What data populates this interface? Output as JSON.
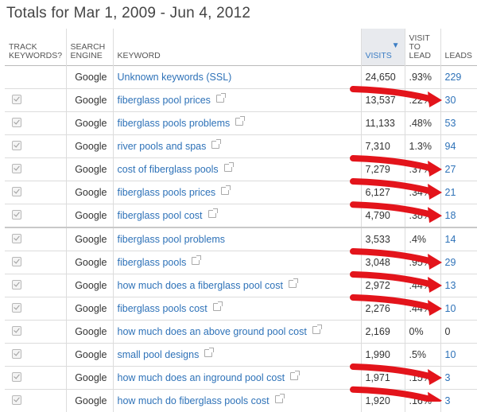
{
  "title": "Totals for Mar 1, 2009 - Jun 4, 2012",
  "headers": {
    "track": "TRACK KEYWORDS?",
    "engine": "SEARCH ENGINE",
    "keyword": "KEYWORD",
    "visits": "VISITS",
    "v2l": "VISIT TO LEAD",
    "leads": "LEADS"
  },
  "rows": [
    {
      "tracked": false,
      "engine": "Google",
      "keyword": "Unknown keywords (SSL)",
      "link": false,
      "visits": "24,650",
      "v2l": ".93%",
      "leads": "229"
    },
    {
      "tracked": true,
      "engine": "Google",
      "keyword": "fiberglass pool prices",
      "link": true,
      "visits": "13,537",
      "v2l": ".22%",
      "leads": "30"
    },
    {
      "tracked": true,
      "engine": "Google",
      "keyword": "fiberglass pools problems",
      "link": true,
      "visits": "11,133",
      "v2l": ".48%",
      "leads": "53"
    },
    {
      "tracked": true,
      "engine": "Google",
      "keyword": "river pools and spas",
      "link": true,
      "visits": "7,310",
      "v2l": "1.3%",
      "leads": "94"
    },
    {
      "tracked": true,
      "engine": "Google",
      "keyword": "cost of fiberglass pools",
      "link": true,
      "visits": "7,279",
      "v2l": ".37%",
      "leads": "27"
    },
    {
      "tracked": true,
      "engine": "Google",
      "keyword": "fiberglass pools prices",
      "link": true,
      "visits": "6,127",
      "v2l": ".34%",
      "leads": "21"
    },
    {
      "tracked": true,
      "engine": "Google",
      "keyword": "fiberglass pool cost",
      "link": true,
      "visits": "4,790",
      "v2l": ".38%",
      "leads": "18"
    },
    {
      "tracked": true,
      "engine": "Google",
      "keyword": "fiberglass pool problems",
      "link": false,
      "visits": "3,533",
      "v2l": ".4%",
      "leads": "14"
    },
    {
      "tracked": true,
      "engine": "Google",
      "keyword": "fiberglass pools",
      "link": true,
      "visits": "3,048",
      "v2l": ".95%",
      "leads": "29"
    },
    {
      "tracked": true,
      "engine": "Google",
      "keyword": "how much does a fiberglass pool cost",
      "link": true,
      "visits": "2,972",
      "v2l": ".44%",
      "leads": "13"
    },
    {
      "tracked": true,
      "engine": "Google",
      "keyword": "fiberglass pools cost",
      "link": true,
      "visits": "2,276",
      "v2l": ".44%",
      "leads": "10"
    },
    {
      "tracked": true,
      "engine": "Google",
      "keyword": "how much does an above ground pool cost",
      "link": true,
      "visits": "2,169",
      "v2l": "0%",
      "leads": "0"
    },
    {
      "tracked": true,
      "engine": "Google",
      "keyword": "small pool designs",
      "link": true,
      "visits": "1,990",
      "v2l": ".5%",
      "leads": "10"
    },
    {
      "tracked": true,
      "engine": "Google",
      "keyword": "how much does an inground pool cost",
      "link": true,
      "visits": "1,971",
      "v2l": ".15%",
      "leads": "3"
    },
    {
      "tracked": true,
      "engine": "Google",
      "keyword": "how much do fiberglass pools cost",
      "link": true,
      "visits": "1,920",
      "v2l": ".16%",
      "leads": "3"
    }
  ],
  "arrow_rows": [
    1,
    4,
    5,
    6,
    8,
    9,
    10,
    13,
    14
  ],
  "colors": {
    "link": "#2e72b8",
    "arrow": "#e3141b",
    "sorted_header_bg": "#e8eaee"
  }
}
